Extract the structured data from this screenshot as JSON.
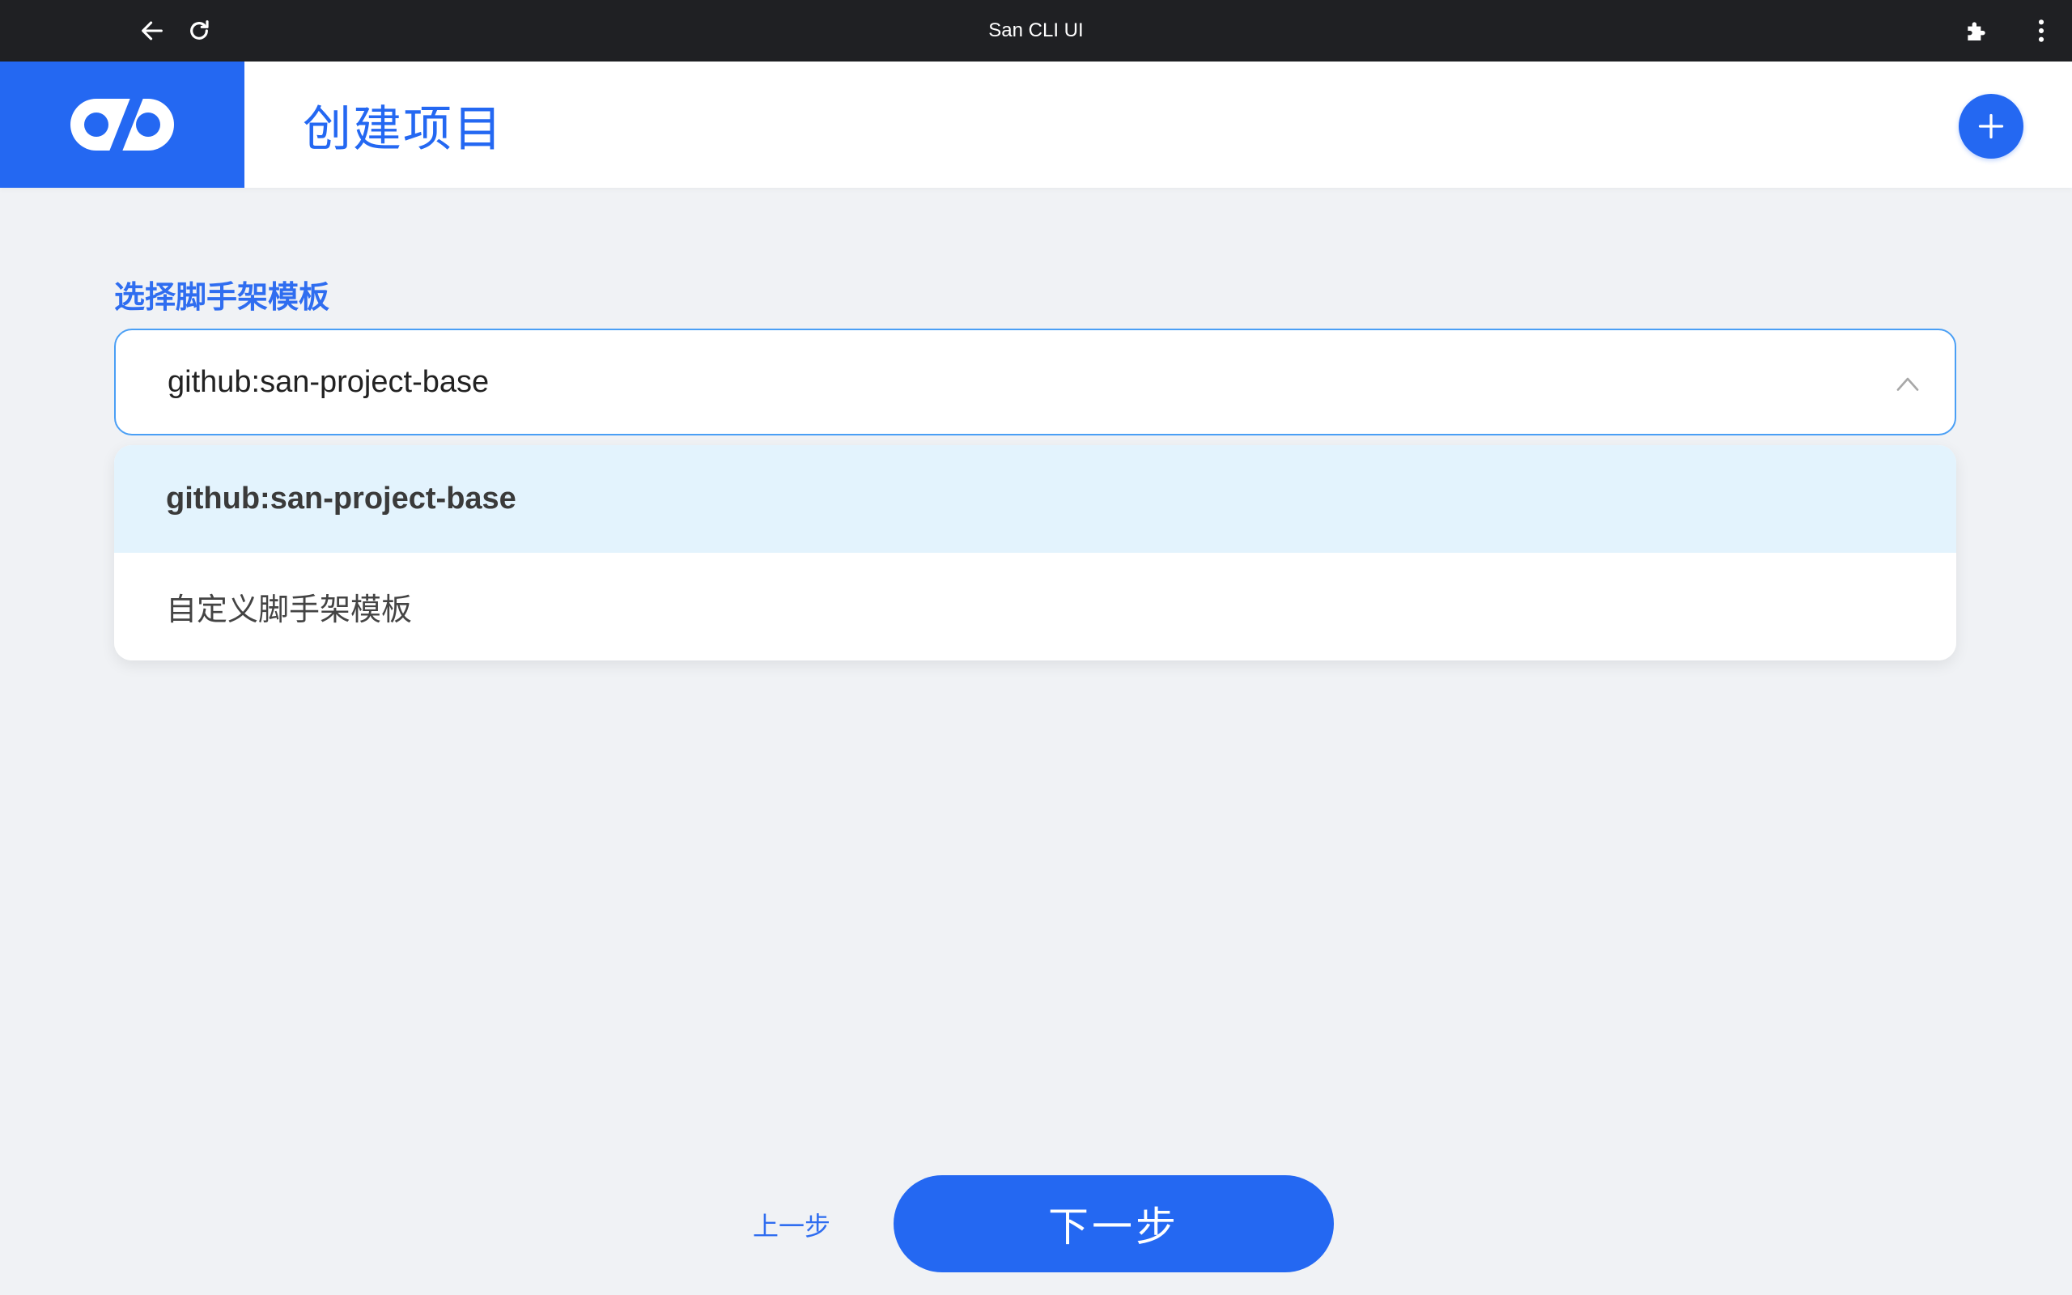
{
  "browser": {
    "title": "San CLI UI",
    "icons": [
      "back-arrow-icon",
      "reload-icon",
      "extensions-puzzle-icon",
      "more-vertical-icon"
    ]
  },
  "header": {
    "logo": "san-logo-icon",
    "title": "创建项目",
    "add_icon": "plus-icon",
    "accent_color": "#2468f2"
  },
  "form": {
    "label": "选择脚手架模板",
    "select": {
      "value": "github:san-project-base",
      "arrow_icon": "chevron-up-icon",
      "expanded": true,
      "options": [
        {
          "label": "github:san-project-base",
          "selected": true
        },
        {
          "label": "自定义脚手架模板",
          "selected": false
        }
      ]
    }
  },
  "footer": {
    "prev_label": "上一步",
    "next_label": "下一步"
  }
}
